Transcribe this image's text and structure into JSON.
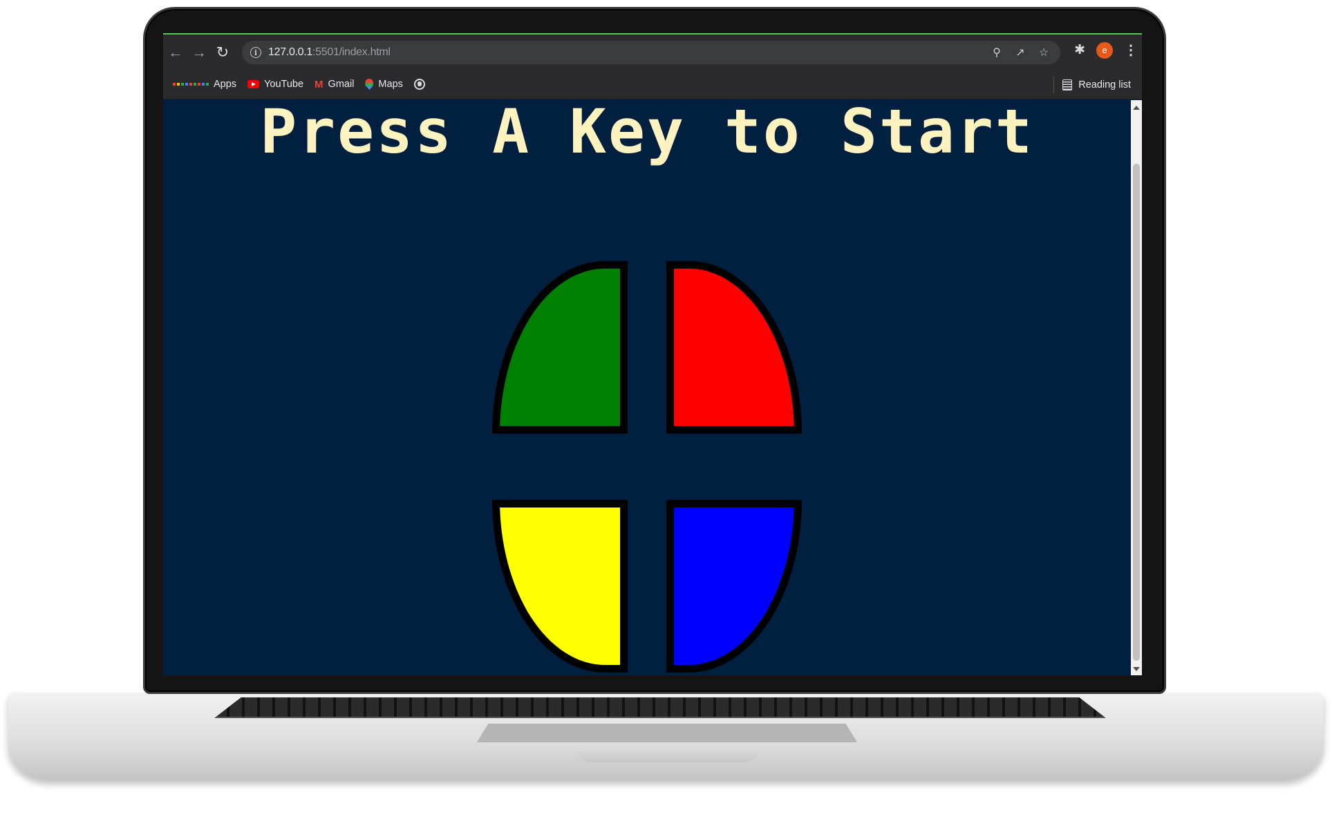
{
  "browser": {
    "url_host": "127.0.0.1",
    "url_path": ":5501/index.html",
    "profile_initial": "e",
    "nav_icons": [
      "back-icon",
      "forward-icon",
      "reload-icon"
    ],
    "omnibox_icons": [
      "zoom-icon",
      "share-icon",
      "star-icon"
    ]
  },
  "bookmarks": {
    "items": [
      {
        "label": "Apps",
        "icon": "apps-grid-icon"
      },
      {
        "label": "YouTube",
        "icon": "youtube-icon"
      },
      {
        "label": "Gmail",
        "icon": "gmail-icon"
      },
      {
        "label": "Maps",
        "icon": "maps-icon"
      }
    ],
    "reading_list_label": "Reading list"
  },
  "game": {
    "title": "Press A Key to Start",
    "buttons": [
      {
        "id": "green",
        "color": "#008000"
      },
      {
        "id": "red",
        "color": "#ff0000"
      },
      {
        "id": "yellow",
        "color": "#ffff00"
      },
      {
        "id": "blue",
        "color": "#0000ff"
      }
    ],
    "background_color": "#011f3f",
    "title_color": "#fef2bf"
  }
}
